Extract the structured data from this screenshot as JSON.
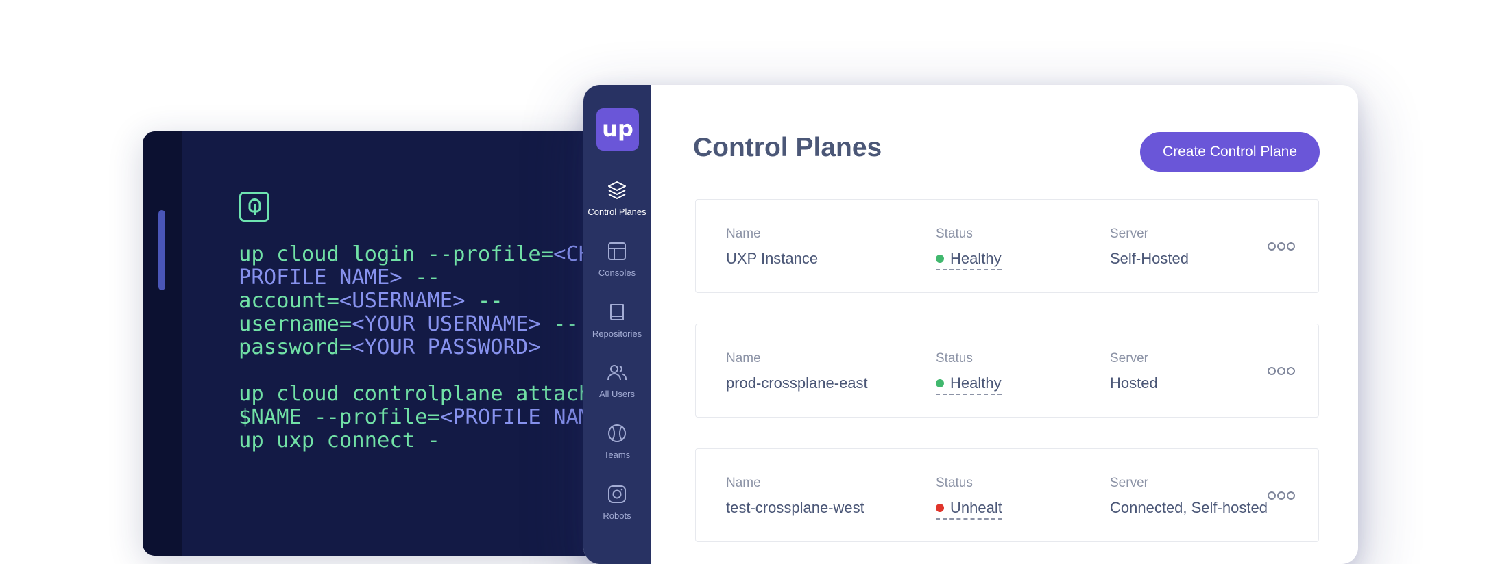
{
  "terminal": {
    "lines": [
      [
        {
          "t": "up cloud login --profile=",
          "c": "green"
        },
        {
          "t": "<CH",
          "c": "purple"
        }
      ],
      [
        {
          "t": "PROFILE NAME>",
          "c": "purple"
        },
        {
          "t": " --",
          "c": "green"
        }
      ],
      [
        {
          "t": "account=",
          "c": "green"
        },
        {
          "t": "<USERNAME>",
          "c": "purple"
        },
        {
          "t": " --",
          "c": "green"
        }
      ],
      [
        {
          "t": "username=",
          "c": "green"
        },
        {
          "t": "<YOUR USERNAME>",
          "c": "purple"
        },
        {
          "t": " --",
          "c": "green"
        }
      ],
      [
        {
          "t": "password=",
          "c": "green"
        },
        {
          "t": "<YOUR PASSWORD>",
          "c": "purple"
        }
      ],
      [
        {
          "t": "",
          "c": "green"
        }
      ],
      [
        {
          "t": "up cloud controlplane attach",
          "c": "green"
        }
      ],
      [
        {
          "t": "$NAME --profile=",
          "c": "green"
        },
        {
          "t": "<PROFILE NAM",
          "c": "purple"
        }
      ],
      [
        {
          "t": "up uxp connect -",
          "c": "green"
        }
      ]
    ],
    "colors": {
      "green": "#71e1a6",
      "purple": "#8792ee"
    }
  },
  "app": {
    "logo_text": "up",
    "nav": [
      {
        "label": "Control Planes",
        "icon": "layers-icon",
        "active": true
      },
      {
        "label": "Consoles",
        "icon": "layout-icon",
        "active": false
      },
      {
        "label": "Repositories",
        "icon": "book-icon",
        "active": false
      },
      {
        "label": "All Users",
        "icon": "users-icon",
        "active": false
      },
      {
        "label": "Teams",
        "icon": "baseball-icon",
        "active": false
      },
      {
        "label": "Robots",
        "icon": "robot-icon",
        "active": false
      }
    ],
    "title": "Control Planes",
    "create_button": "Create Control Plane",
    "columns": {
      "name": "Name",
      "status": "Status",
      "server": "Server"
    },
    "rows": [
      {
        "name": "UXP Instance",
        "status": "Healthy",
        "status_color": "#41b86e",
        "server": "Self-Hosted"
      },
      {
        "name": "prod-crossplane-east",
        "status": "Healthy",
        "status_color": "#41b86e",
        "server": "Hosted"
      },
      {
        "name": "test-crossplane-west",
        "status": "Unhealt",
        "status_color": "#e0352b",
        "server": "Connected, Self-hosted"
      }
    ],
    "colors": {
      "accent": "#6a56d8",
      "sidebar": "#283263"
    }
  }
}
